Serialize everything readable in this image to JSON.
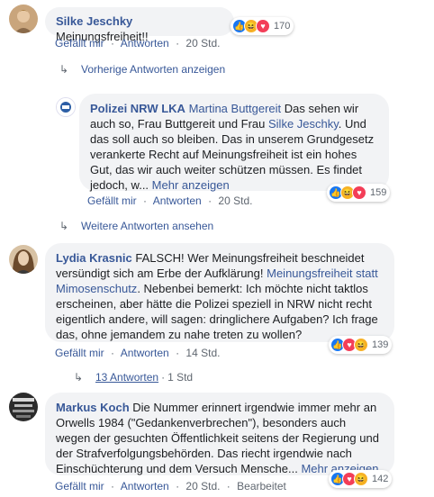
{
  "comments": [
    {
      "author": "Silke Jeschky",
      "text": "Meinungsfreiheit!!",
      "reaction_count": "170",
      "actions": {
        "like": "Gefällt mir",
        "reply": "Antworten",
        "time": "20 Std."
      }
    },
    {
      "author": "Polizei NRW LKA",
      "mention1": "Martina Buttgereit",
      "text1": " Das sehen wir auch so, Frau Buttgereit und Frau ",
      "mention2": "Silke Jeschky",
      "text2": ". Und das soll auch so bleiben. Das in unserem Grundgesetz verankerte Recht auf Meinungsfreiheit ist ein hohes Gut, das wir auch weiter schützen müssen. Es findet jedoch, w...",
      "more": "Mehr anzeigen",
      "reaction_count": "159",
      "actions": {
        "like": "Gefällt mir",
        "reply": "Antworten",
        "time": "20 Std."
      }
    },
    {
      "author": "Lydia Krasnic",
      "text1": " FALSCH! Wer Meinungsfreiheit beschneidet versündigt sich am Erbe der Aufklärung! ",
      "tag": "Meinungsfreiheit statt Mimosenschutz",
      "text2": ". Nebenbei bemerkt: Ich möchte nicht taktlos erscheinen, aber hätte die Polizei speziell in NRW nicht recht eigentlich andere, will sagen: dringlichere Aufgaben? Ich frage das, ohne jemandem zu nahe treten zu wollen?",
      "reaction_count": "139",
      "actions": {
        "like": "Gefällt mir",
        "reply": "Antworten",
        "time": "14 Std."
      }
    },
    {
      "author": "Markus Koch",
      "text": " Die Nummer erinnert irgendwie immer mehr an Orwells 1984 (\"Gedankenverbrechen\"), besonders auch wegen der gesuchten Öffentlichkeit seitens der Regierung und der Strafverfolgungsbehörden. Das riecht irgendwie nach Einschüchterung und dem Versuch Mensche...",
      "more": "Mehr anzeigen",
      "reaction_count": "142",
      "actions": {
        "like": "Gefällt mir",
        "reply": "Antworten",
        "time": "20 Std.",
        "edited": "Bearbeitet"
      }
    }
  ],
  "links": {
    "previous_replies": "Vorherige Antworten anzeigen",
    "more_replies": "Weitere Antworten ansehen",
    "replies_count": "13 Antworten",
    "replies_time": "1 Std"
  },
  "sep": "·",
  "colors": {
    "link": "#385898",
    "bubble": "#f2f3f5",
    "like": "#1877f2",
    "love": "#f33e58",
    "haha": "#f7b125"
  },
  "icons": {
    "reply_arrow": "reply-arrow-icon",
    "like": "like-reaction-icon",
    "haha": "haha-reaction-icon",
    "love": "love-reaction-icon"
  }
}
